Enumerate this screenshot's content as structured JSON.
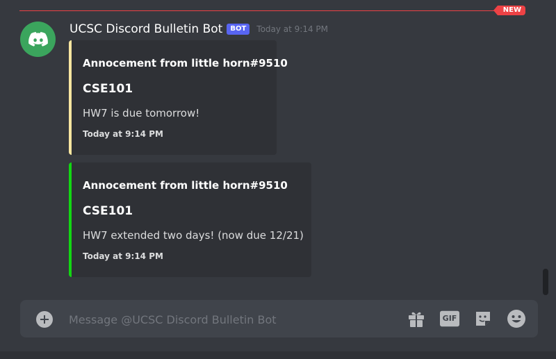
{
  "divider": {
    "badge": "NEW"
  },
  "message": {
    "username": "UCSC Discord Bulletin Bot",
    "bot_tag": "BOT",
    "timestamp": "Today at 9:14 PM"
  },
  "embeds": [
    {
      "accent": "#f8e6a0",
      "author": "Annocement from little horn#9510",
      "title": "CSE101",
      "description": "HW7 is due tomorrow!",
      "footer": "Today at 9:14 PM"
    },
    {
      "accent": "#12d712",
      "author": "Annocement from little horn#9510",
      "title": "CSE101",
      "description": "HW7 extended two days! (now due 12/21)",
      "footer": "Today at 9:14 PM"
    }
  ],
  "composer": {
    "placeholder": "Message @UCSC Discord Bulletin Bot",
    "value": "",
    "buttons": [
      "add-icon",
      "gift-icon",
      "gif-icon",
      "sticker-icon",
      "emoji-icon"
    ],
    "gif_label": "GIF"
  },
  "colors": {
    "background": "#36393f",
    "new_red": "#ed4245",
    "bot_blurple": "#5865f2",
    "avatar_green": "#3ba55d"
  }
}
